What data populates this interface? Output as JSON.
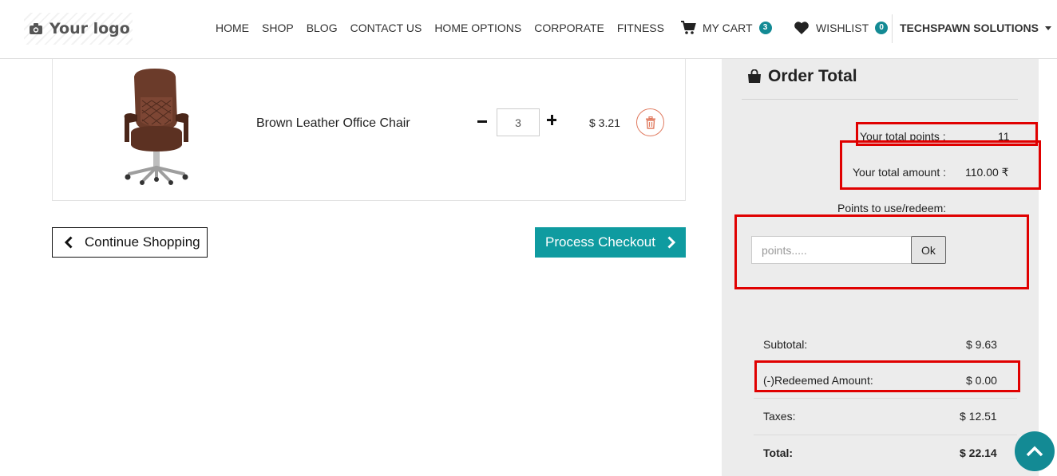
{
  "header": {
    "logo_text": "Your logo",
    "nav": [
      "HOME",
      "SHOP",
      "BLOG",
      "CONTACT US",
      "HOME OPTIONS",
      "CORPORATE",
      "FITNESS"
    ],
    "cart_label": "MY CART",
    "cart_count": "3",
    "wishlist_label": "WISHLIST",
    "wishlist_count": "0",
    "account_name": "TECHSPAWN SOLUTIONS"
  },
  "cart_item": {
    "name": "Brown Leather Office Chair",
    "quantity": "3",
    "price": "$ 3.21"
  },
  "actions": {
    "continue_label": "Continue Shopping",
    "checkout_label": "Process Checkout"
  },
  "order_total": {
    "title": "Order Total",
    "total_points_label": "Your total points :",
    "total_points_value": "11",
    "total_amount_label": "Your total amount :",
    "total_amount_value": "110.00 ₹",
    "redeem_label": "Points to use/redeem:",
    "points_placeholder": "points.....",
    "ok_label": "Ok",
    "subtotal_label": "Subtotal:",
    "subtotal_value": "$ 9.63",
    "redeemed_label": "(-)Redeemed Amount:",
    "redeemed_value": "$ 0.00",
    "taxes_label": "Taxes:",
    "taxes_value": "$ 12.51",
    "total_label": "Total:",
    "total_value": "$ 22.14"
  },
  "colors": {
    "accent": "#0f9ba0",
    "highlight": "#e00000",
    "panel_bg": "#ececec"
  }
}
